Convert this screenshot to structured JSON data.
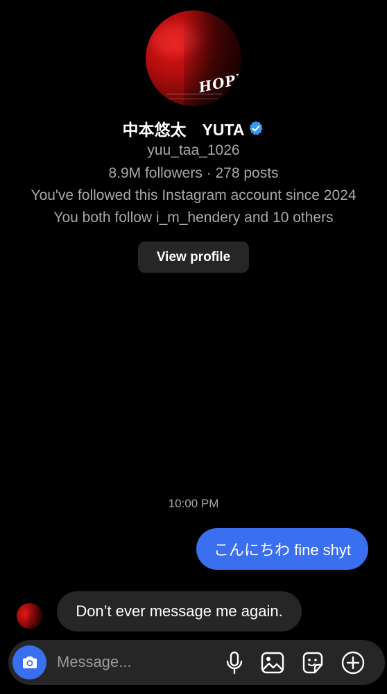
{
  "profile": {
    "display_name": "中本悠太　YUTA",
    "verified": true,
    "username": "yuu_taa_1026",
    "stats": "8.9M followers · 278 posts",
    "followed_since": "You've followed this Instagram account since 2024",
    "mutual": "You both follow i_m_hendery and 10 others",
    "view_profile_label": "View profile",
    "avatar_text": "HOPE"
  },
  "thread": {
    "timestamp": "10:00 PM",
    "messages": [
      {
        "direction": "sent",
        "text": "こんにちわ fine shyt"
      },
      {
        "direction": "received",
        "text": "Don’t ever message me again."
      }
    ]
  },
  "composer": {
    "placeholder": "Message...",
    "icons": [
      "camera-icon",
      "microphone-icon",
      "gallery-icon",
      "sticker-icon",
      "add-icon"
    ]
  },
  "colors": {
    "background": "#000000",
    "accent": "#3a6ff0",
    "bubble_received": "#262626",
    "secondary_text": "#a8a8a8",
    "verified_badge": "#3897f0"
  }
}
